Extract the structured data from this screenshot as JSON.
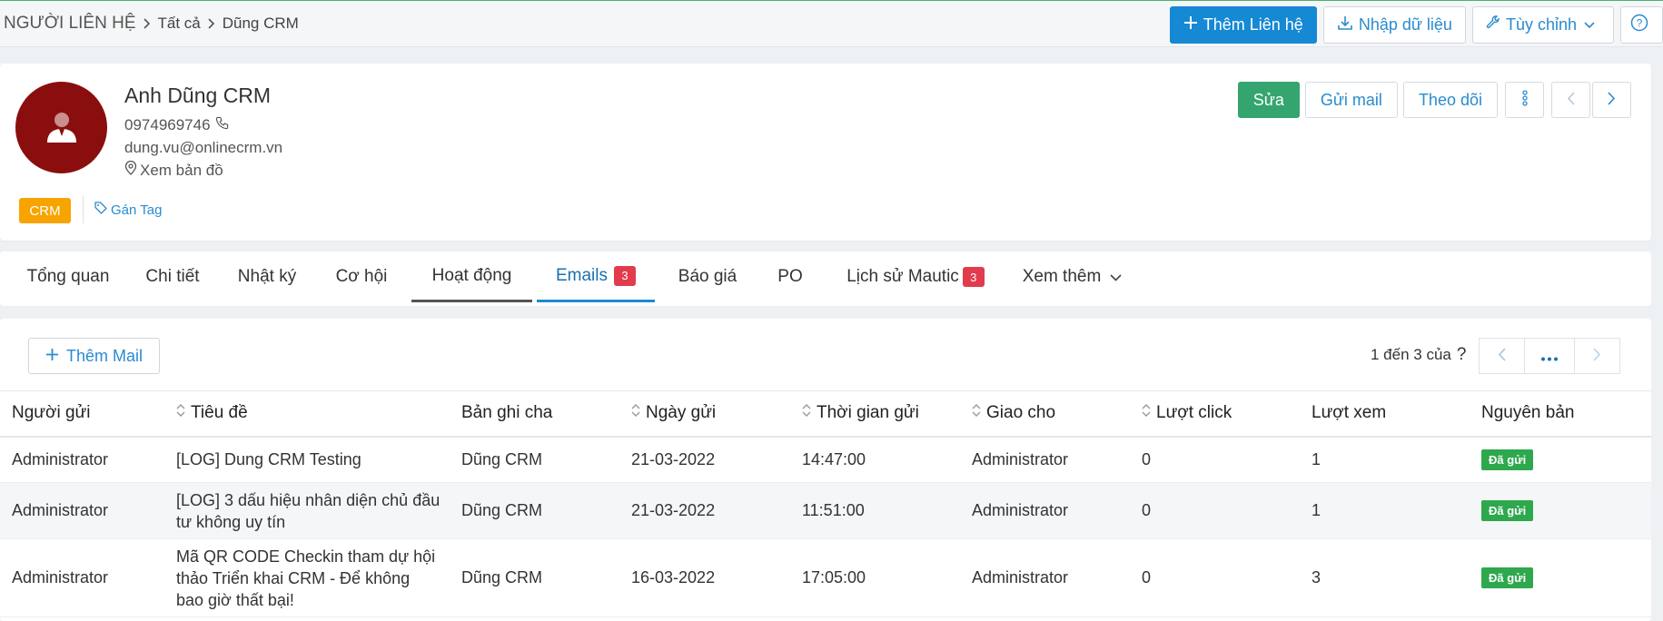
{
  "breadcrumb": {
    "root": "NGƯỜI LIÊN HỆ",
    "level1": "Tất cả",
    "level2": "Dũng CRM"
  },
  "toolbar": {
    "add_contact": "Thêm Liên hệ",
    "import": "Nhập dữ liệu",
    "customize": "Tùy chỉnh"
  },
  "profile": {
    "name": "Anh Dũng CRM",
    "phone": "0974969746",
    "email": "dung.vu@onlinecrm.vn",
    "map": "Xem bản đồ",
    "tag": "CRM",
    "add_tag": "Gán Tag",
    "actions": {
      "edit": "Sửa",
      "send_mail": "Gửi mail",
      "follow": "Theo dõi"
    }
  },
  "tabs": [
    {
      "label": "Tổng quan"
    },
    {
      "label": "Chi tiết"
    },
    {
      "label": "Nhật ký"
    },
    {
      "label": "Cơ hội"
    },
    {
      "label": "Hoạt động"
    },
    {
      "label": "Emails",
      "count": "3"
    },
    {
      "label": "Báo giá"
    },
    {
      "label": "PO"
    },
    {
      "label": "Lịch sử Mautic",
      "count": "3"
    },
    {
      "label": "Xem thêm"
    }
  ],
  "emails": {
    "add_mail": "Thêm Mail",
    "pager_text": "1 đến 3 của",
    "pager_help": "?",
    "columns": [
      "Người gửi",
      "Tiêu đề",
      "Bản ghi cha",
      "Ngày gửi",
      "Thời gian gửi",
      "Giao cho",
      "Lượt click",
      "Lượt xem",
      "Nguyên bản"
    ],
    "rows": [
      {
        "sender": "Administrator",
        "subject": "[LOG] Dung CRM Testing",
        "parent": "Dũng CRM",
        "date": "21-03-2022",
        "time": "14:47:00",
        "assigned": "Administrator",
        "clicks": "0",
        "views": "1",
        "status": "Đã gửi"
      },
      {
        "sender": "Administrator",
        "subject": "[LOG] 3 dấu hiệu nhân diện chủ đầu tư không uy tín",
        "parent": "Dũng CRM",
        "date": "21-03-2022",
        "time": "11:51:00",
        "assigned": "Administrator",
        "clicks": "0",
        "views": "1",
        "status": "Đã gửi"
      },
      {
        "sender": "Administrator",
        "subject": "Mã QR CODE Checkin tham dự hội thảo Triển khai CRM - Để không bao giờ thất bại!",
        "parent": "Dũng CRM",
        "date": "16-03-2022",
        "time": "17:05:00",
        "assigned": "Administrator",
        "clicks": "0",
        "views": "3",
        "status": "Đã gửi"
      }
    ]
  },
  "colors": {
    "primary": "#1589d4",
    "success": "#35a56f",
    "badge_red": "#e23b4d",
    "tag_orange": "#f8a400",
    "avatar_bg": "#8b0e0e"
  }
}
